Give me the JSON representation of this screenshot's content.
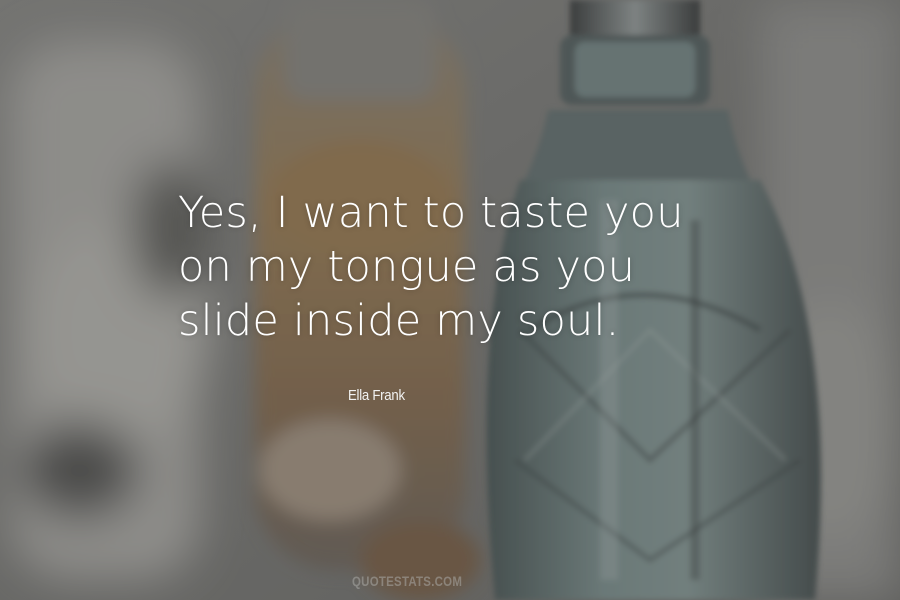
{
  "quote": {
    "lines": [
      "Yes, I want to taste you",
      "on my tongue as you",
      "slide inside my soul."
    ],
    "author": "Ella Frank"
  },
  "watermark": "QUOTESTATS.COM",
  "colors": {
    "text": "#ffffff",
    "overlay": "#5a5a57",
    "bottle_glass": "#6f8a88",
    "amber_liquid": "#9a7a55"
  }
}
